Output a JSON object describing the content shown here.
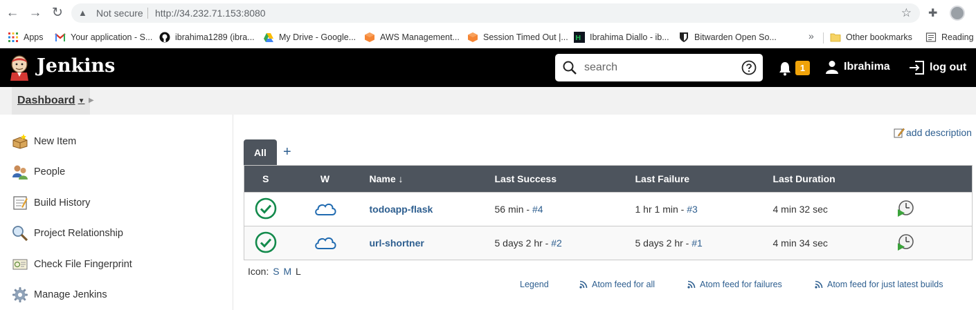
{
  "browser": {
    "not_secure": "Not secure",
    "url": "http://34.232.71.153:8080",
    "bookmarks": [
      {
        "label": "Apps",
        "icon": "apps-grid-icon"
      },
      {
        "label": "Your application - S...",
        "icon": "gmail-icon"
      },
      {
        "label": "ibrahima1289 (ibra...",
        "icon": "github-icon"
      },
      {
        "label": "My Drive - Google...",
        "icon": "google-drive-icon"
      },
      {
        "label": "AWS Management...",
        "icon": "aws-icon"
      },
      {
        "label": "Session Timed Out |...",
        "icon": "aws-icon"
      },
      {
        "label": "Ibrahima Diallo - ib...",
        "icon": "hackerrank-icon"
      },
      {
        "label": "Bitwarden Open So...",
        "icon": "bitwarden-icon"
      },
      {
        "label": "Other bookmarks",
        "icon": "folder-icon"
      },
      {
        "label": "Reading l",
        "icon": "reading-list-icon"
      }
    ],
    "more": "»"
  },
  "header": {
    "title": "Jenkins",
    "search_placeholder": "search",
    "notification_count": "1",
    "user": "Ibrahima",
    "logout": "log out"
  },
  "breadcrumb": {
    "dashboard": "Dashboard"
  },
  "side_panel": [
    {
      "label": "New Item",
      "icon": "new-item-icon"
    },
    {
      "label": "People",
      "icon": "people-icon"
    },
    {
      "label": "Build History",
      "icon": "build-history-icon"
    },
    {
      "label": "Project Relationship",
      "icon": "magnifier-icon"
    },
    {
      "label": "Check File Fingerprint",
      "icon": "fingerprint-icon"
    },
    {
      "label": "Manage Jenkins",
      "icon": "gear-icon"
    }
  ],
  "main": {
    "add_description": "add description",
    "tab_all": "All",
    "tab_add": "+",
    "columns": [
      "S",
      "W",
      "Name ↓",
      "Last Success",
      "Last Failure",
      "Last Duration"
    ],
    "jobs": [
      {
        "name": "todoapp-flask",
        "last_success_time": "56 min - ",
        "last_success_build": "#4",
        "last_failure_time": "1 hr 1 min - ",
        "last_failure_build": "#3",
        "last_duration": "4 min 32 sec",
        "status": "success",
        "weather": "cloudy"
      },
      {
        "name": "url-shortner",
        "last_success_time": "5 days 2 hr - ",
        "last_success_build": "#2",
        "last_failure_time": "5 days 2 hr - ",
        "last_failure_build": "#1",
        "last_duration": "4 min 34 sec",
        "status": "success",
        "weather": "cloudy"
      }
    ],
    "icon_label": "Icon:",
    "icon_sizes": [
      "S",
      "M",
      "L"
    ],
    "footer_links": {
      "legend": "Legend",
      "atom_all": "Atom feed for all",
      "atom_failures": "Atom feed for failures",
      "atom_latest": "Atom feed for just latest builds"
    }
  },
  "colors": {
    "header_bg": "#000000",
    "link": "#2d5e8f",
    "success": "#138a4c",
    "badge": "#f0a30a",
    "table_header": "#4d545d"
  }
}
